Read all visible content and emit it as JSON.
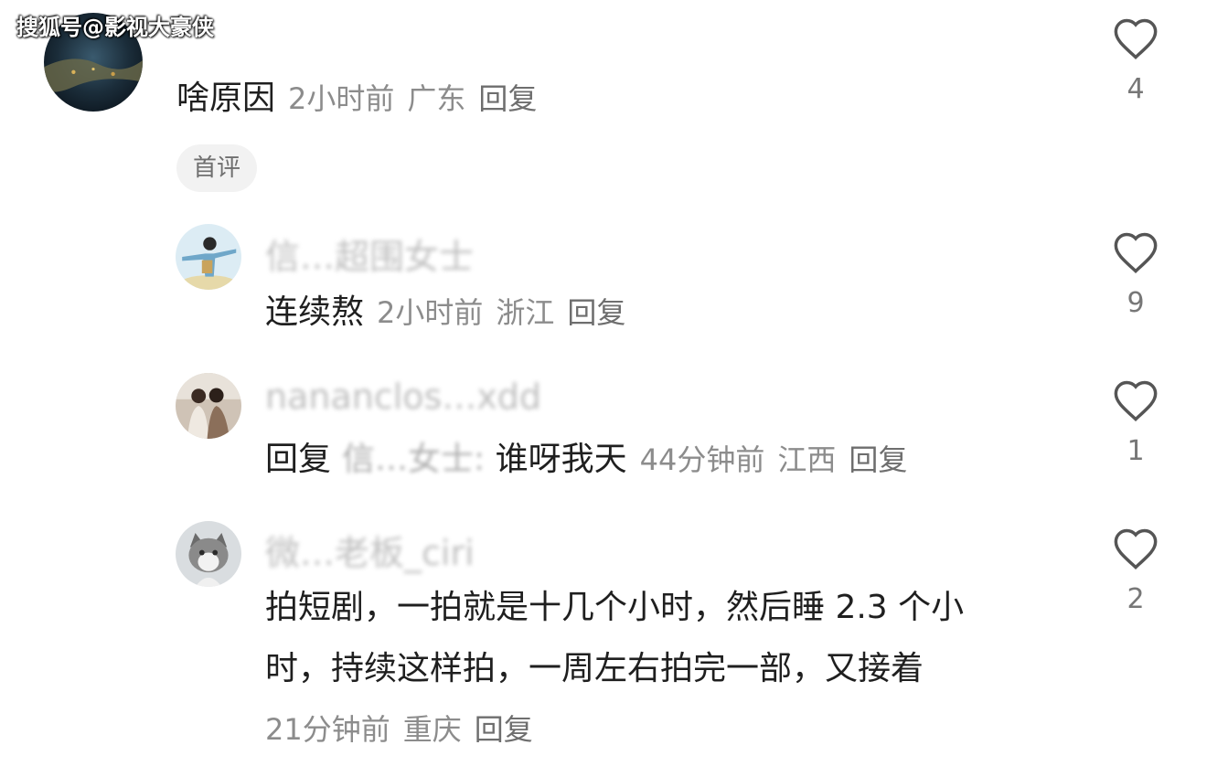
{
  "watermark": "搜狐号@影视大豪侠",
  "comments": [
    {
      "text": "啥原因",
      "time": "2小时前",
      "location": "广东",
      "reply": "回复",
      "badge": "首评",
      "likes": "4"
    },
    {
      "username": "信…超围女士",
      "text": "连续熬",
      "time": "2小时前",
      "location": "浙江",
      "reply": "回复",
      "likes": "9"
    },
    {
      "username": "nananclos…xdd",
      "reply_prefix": "回复",
      "reply_to": "信…女士:",
      "text": "谁呀我天",
      "time": "44分钟前",
      "location": "江西",
      "reply": "回复",
      "likes": "1"
    },
    {
      "username": "微…老板_ciri",
      "text_line1": "拍短剧，一拍就是十几个小时，然后睡 2.3 个小",
      "text_line2": "时，持续这样拍，一周左右拍完一部，又接着",
      "time": "21分钟前",
      "location": "重庆",
      "reply": "回复",
      "likes": "2"
    }
  ],
  "icons": {
    "like": "heart-outline-icon"
  },
  "colors": {
    "text": "#1f1f1f",
    "meta": "#8c8c8c",
    "icon": "#555555"
  }
}
